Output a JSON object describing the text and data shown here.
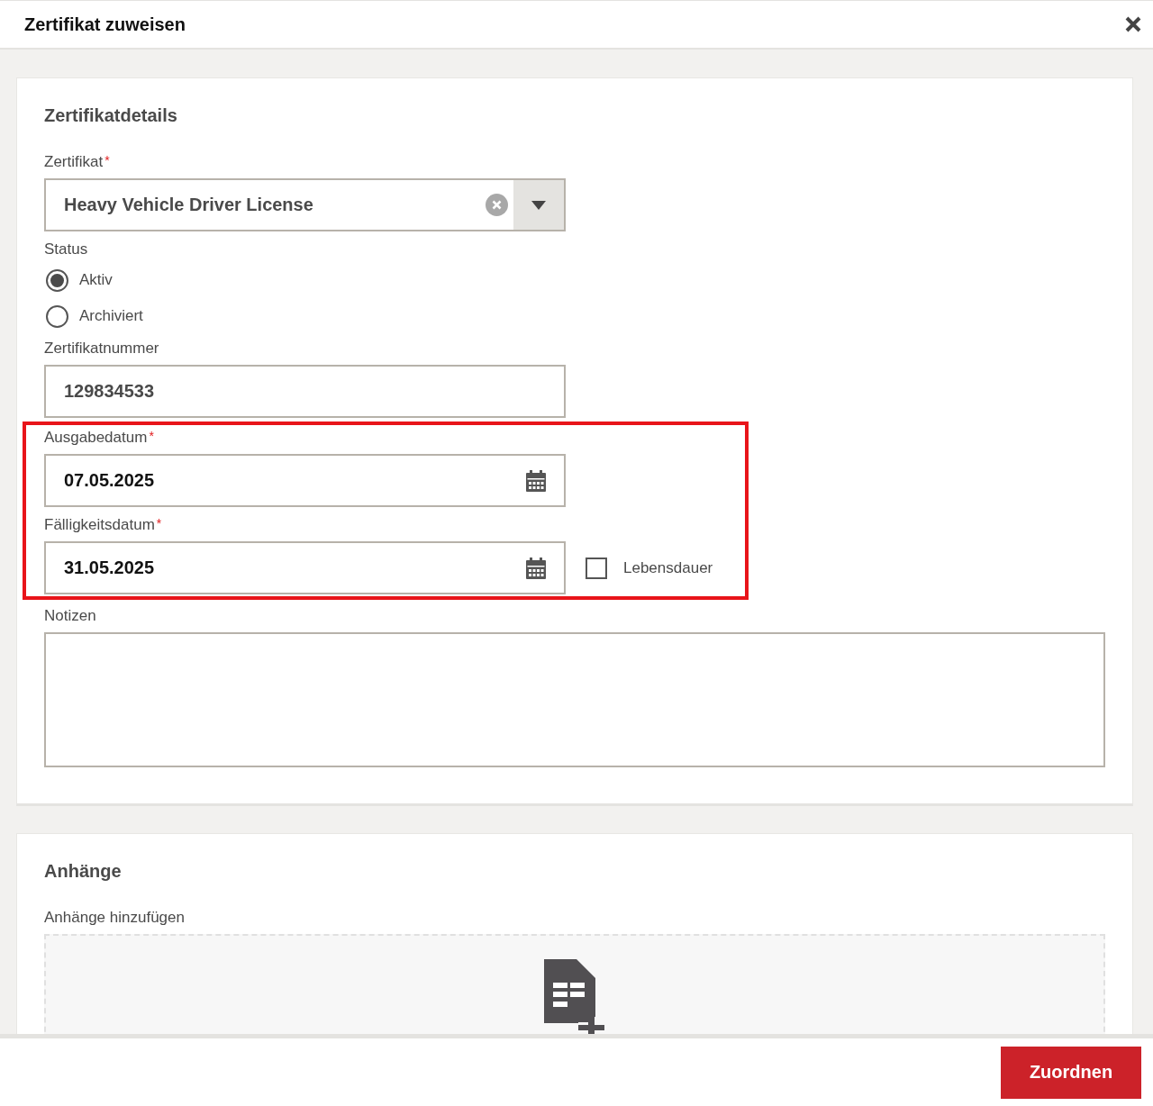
{
  "dialog": {
    "title": "Zertifikat zuweisen"
  },
  "details": {
    "heading": "Zertifikatdetails",
    "certificate": {
      "label": "Zertifikat",
      "required_mark": "*",
      "value": "Heavy Vehicle Driver License"
    },
    "status": {
      "label": "Status",
      "options": [
        {
          "label": "Aktiv",
          "selected": true
        },
        {
          "label": "Archiviert",
          "selected": false
        }
      ]
    },
    "number": {
      "label": "Zertifikatnummer",
      "value": "129834533"
    },
    "issue_date": {
      "label": "Ausgabedatum",
      "required_mark": "*",
      "value": "07.05.2025"
    },
    "due_date": {
      "label": "Fälligkeitsdatum",
      "required_mark": "*",
      "value": "31.05.2025"
    },
    "lifetime": {
      "label": "Lebensdauer",
      "checked": false
    },
    "notes": {
      "label": "Notizen"
    }
  },
  "attachments": {
    "heading": "Anhänge",
    "label": "Anhänge hinzufügen"
  },
  "footer": {
    "button": "Zuordnen"
  }
}
